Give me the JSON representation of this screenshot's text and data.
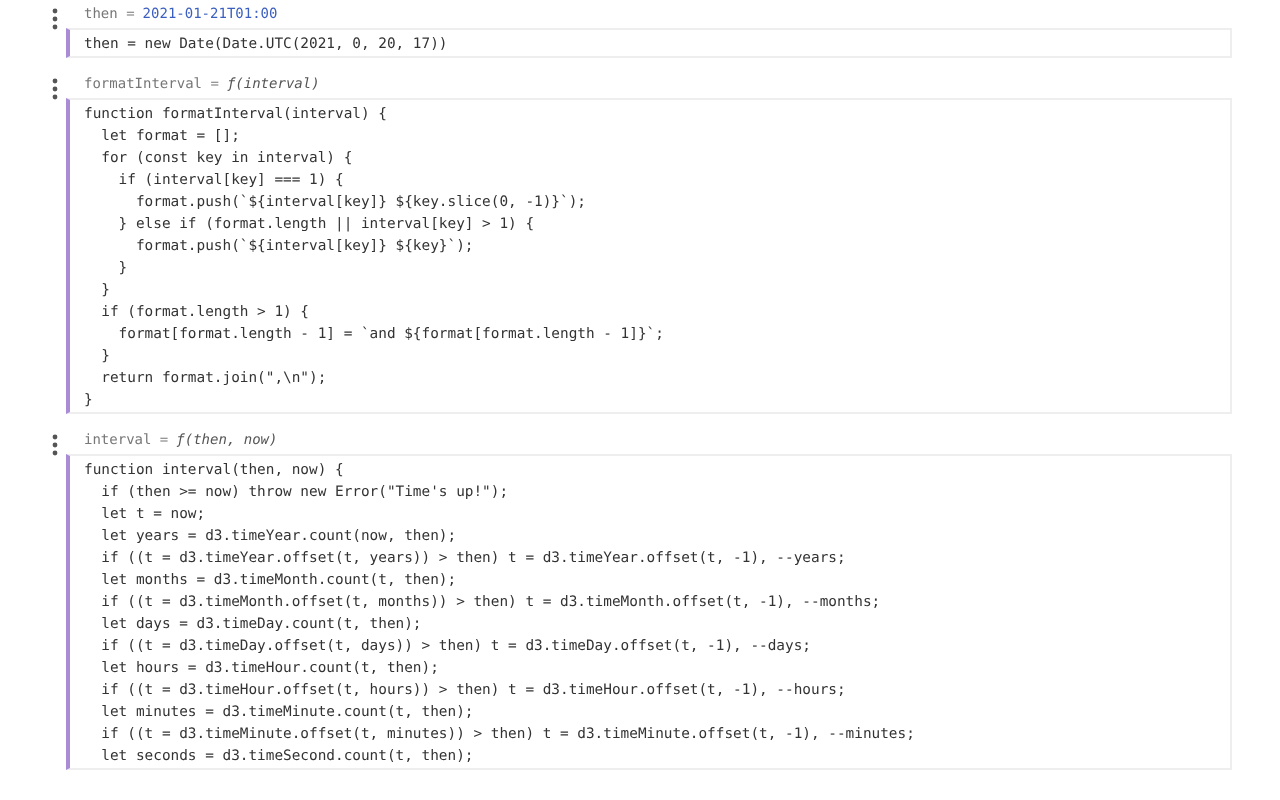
{
  "cells": [
    {
      "output": {
        "name": "then =",
        "value": "2021-01-21T01:00",
        "kind": "date"
      },
      "focused": true,
      "code": [
        "then = new Date(Date.UTC(2021, 0, 20, 17))"
      ]
    },
    {
      "output": {
        "name": "formatInterval =",
        "value": "ƒ(interval)",
        "kind": "function"
      },
      "focused": true,
      "code": [
        "function formatInterval(interval) {",
        "  let format = [];",
        "  for (const key in interval) {",
        "    if (interval[key] === 1) {",
        "      format.push(`${interval[key]} ${key.slice(0, -1)}`);",
        "    } else if (format.length || interval[key] > 1) {",
        "      format.push(`${interval[key]} ${key}`);",
        "    }",
        "  }",
        "  if (format.length > 1) {",
        "    format[format.length - 1] = `and ${format[format.length - 1]}`;",
        "  }",
        "  return format.join(\",\\n\");",
        "}"
      ]
    },
    {
      "output": {
        "name": "interval =",
        "value": "ƒ(then, now)",
        "kind": "function"
      },
      "focused": true,
      "code": [
        "function interval(then, now) {",
        "  if (then >= now) throw new Error(\"Time's up!\");",
        "  let t = now;",
        "  let years = d3.timeYear.count(now, then);",
        "  if ((t = d3.timeYear.offset(t, years)) > then) t = d3.timeYear.offset(t, -1), --years;",
        "  let months = d3.timeMonth.count(t, then);",
        "  if ((t = d3.timeMonth.offset(t, months)) > then) t = d3.timeMonth.offset(t, -1), --months;",
        "  let days = d3.timeDay.count(t, then);",
        "  if ((t = d3.timeDay.offset(t, days)) > then) t = d3.timeDay.offset(t, -1), --days;",
        "  let hours = d3.timeHour.count(t, then);",
        "  if ((t = d3.timeHour.offset(t, hours)) > then) t = d3.timeHour.offset(t, -1), --hours;",
        "  let minutes = d3.timeMinute.count(t, then);",
        "  if ((t = d3.timeMinute.offset(t, minutes)) > then) t = d3.timeMinute.offset(t, -1), --minutes;",
        "  let seconds = d3.timeSecond.count(t, then);"
      ]
    }
  ]
}
